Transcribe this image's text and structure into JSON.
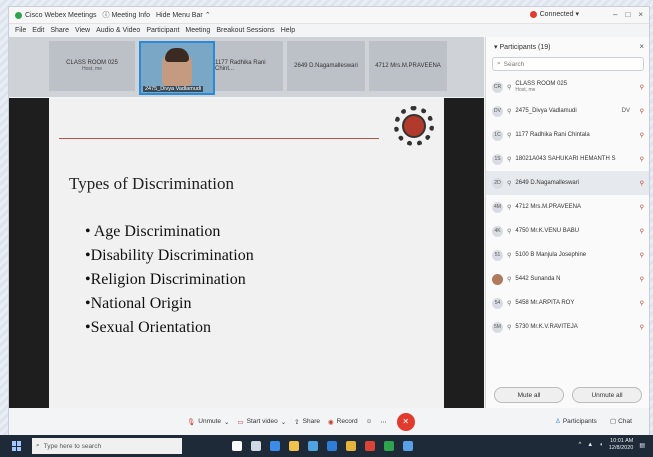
{
  "titlebar": {
    "items": [
      "Cisco Webex Meetings",
      "Meeting Info",
      "Hide Menu Bar"
    ],
    "connected": "Connected",
    "controls": [
      "–",
      "□",
      "×"
    ]
  },
  "menu": [
    "File",
    "Edit",
    "Share",
    "View",
    "Audio & Video",
    "Participant",
    "Meeting",
    "Breakout Sessions",
    "Help"
  ],
  "strip": {
    "tiles": [
      {
        "label": "CLASS ROOM 025",
        "sub": "Host, me"
      },
      {
        "label": "2475_Divya Vadlamudi",
        "self": true
      },
      {
        "label": "1177 Radhika Rani Chint..."
      },
      {
        "label": "2649 D.Nagamalleswari"
      },
      {
        "label": "4712 Mrs.M.PRAVEENA"
      }
    ]
  },
  "slide": {
    "title": "Types of Discrimination",
    "bullets": [
      "• Age Discrimination",
      "•Disability Discrimination",
      "•Religion Discrimination",
      "•National Origin",
      "•Sexual Orientation"
    ]
  },
  "participants": {
    "header": "Participants (19)",
    "search_placeholder": "Search",
    "rows": [
      {
        "initials": "CR",
        "name": "CLASS ROOM 025",
        "sub": "Host, me",
        "side": ""
      },
      {
        "initials": "DV",
        "name": "2475_Divya Vadlamudi",
        "sub": "",
        "side": "DV"
      },
      {
        "initials": "1C",
        "name": "1177 Radhika Rani Chintala",
        "sub": "",
        "side": ""
      },
      {
        "initials": "1S",
        "name": "18021A043 SAHUKARI HEMANTH S",
        "sub": "",
        "side": ""
      },
      {
        "initials": "2D",
        "name": "2649 D.Nagamalleswari",
        "sub": "",
        "side": ""
      },
      {
        "initials": "4M",
        "name": "4712 Mrs.M.PRAVEENA",
        "sub": "",
        "side": ""
      },
      {
        "initials": "4K",
        "name": "4750 Mr.K.VENU BABU",
        "sub": "",
        "side": ""
      },
      {
        "initials": "51",
        "name": "5100 B Manjula Josephine",
        "sub": "",
        "side": ""
      },
      {
        "initials": "",
        "name": "5442 Sunanda N",
        "sub": "",
        "side": "",
        "photo": true
      },
      {
        "initials": "54",
        "name": "5458 Mr.ARPITA ROY",
        "sub": "",
        "side": ""
      },
      {
        "initials": "5M",
        "name": "5730 Mr.K.V.RAVITEJA",
        "sub": "",
        "side": ""
      }
    ],
    "mute_all": "Mute all",
    "unmute_all": "Unmute all"
  },
  "controls": {
    "unmute": "Unmute",
    "start_video": "Start video",
    "share": "Share",
    "record": "Record",
    "participants": "Participants",
    "chat": "Chat"
  },
  "taskbar": {
    "search_placeholder": "Type here to search",
    "time": "10:01 AM",
    "date": "12/8/2020"
  },
  "colors": {
    "accent": "#2b8ad8",
    "end_call": "#e23b2e",
    "slide_rule": "#b2574a"
  }
}
